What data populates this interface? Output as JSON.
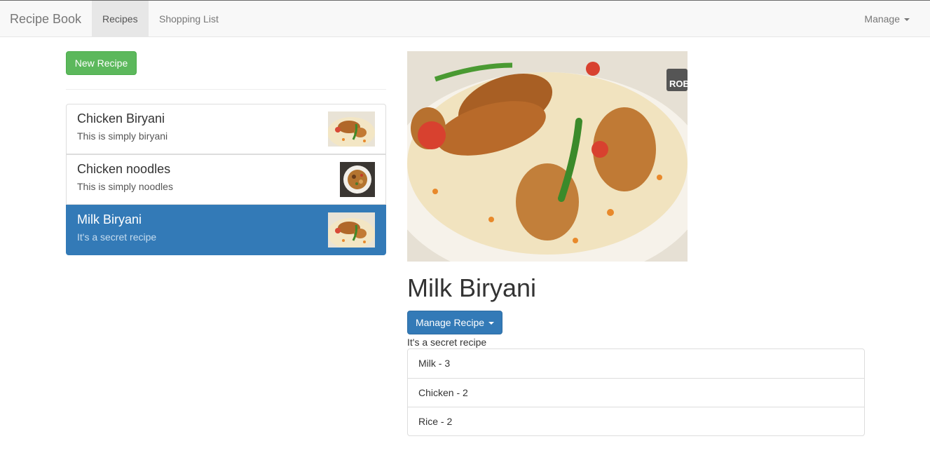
{
  "navbar": {
    "brand": "Recipe Book",
    "links": [
      {
        "label": "Recipes",
        "active": true
      },
      {
        "label": "Shopping List",
        "active": false
      }
    ],
    "manage_label": "Manage"
  },
  "sidebar": {
    "new_recipe_label": "New Recipe",
    "recipes": [
      {
        "name": "Chicken Biryani",
        "description": "This is simply biryani",
        "active": false
      },
      {
        "name": "Chicken noodles",
        "description": "This is simply noodles",
        "active": false
      },
      {
        "name": "Milk Biryani",
        "description": "It's a secret recipe",
        "active": true
      }
    ]
  },
  "detail": {
    "watermark": "ROB",
    "title": "Milk Biryani",
    "manage_label": "Manage Recipe",
    "description": "It's a secret recipe",
    "ingredients": [
      {
        "label": "Milk - 3"
      },
      {
        "label": "Chicken - 2"
      },
      {
        "label": "Rice - 2"
      }
    ]
  },
  "colors": {
    "primary": "#337ab7",
    "success": "#5cb85c",
    "navbar_bg": "#f8f8f8"
  }
}
